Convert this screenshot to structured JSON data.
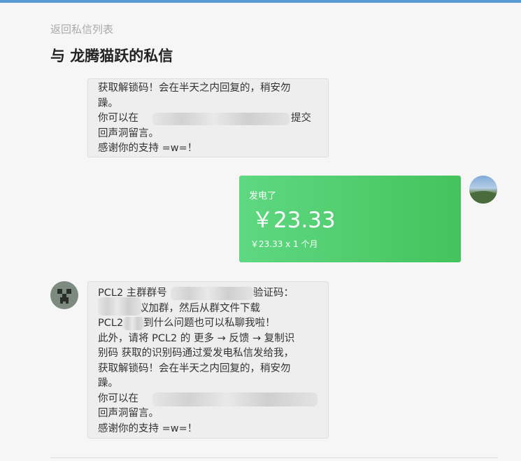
{
  "nav": {
    "back_label": "返回私信列表"
  },
  "header": {
    "title": "与 龙腾猫跃的私信"
  },
  "messages": {
    "first": {
      "lines": [
        "获取解锁码！会在半天之内回复的，稍安勿",
        "躁。",
        "你可以在",
        "提交",
        "回声洞留言。",
        "感谢你的支持 =w=！"
      ]
    },
    "sponsor": {
      "label": "发电了",
      "amount": "￥23.33",
      "detail": "￥23.33 x 1 个月"
    },
    "second": {
      "lines": [
        "PCL2 主群群号",
        "验证码：",
        "很强烈建议加群，然后从群文件下载",
        "PCL2，遇到什么问题也可以私聊我啦！",
        "此外，请将 PCL2 的 更多 → 反馈 → 复制识",
        "别码 获取的识别码通过爱发电私信发给我，",
        "获取解锁码！会在半天之内回复的，稍安勿",
        "躁。",
        "你可以在",
        "回声洞留言。",
        "感谢你的支持 =w=！"
      ]
    }
  },
  "colors": {
    "sponsor_start": "#5fd882",
    "sponsor_end": "#44c35c",
    "bubble": "#eeeeee",
    "top_bar": "#5b9bd5"
  },
  "icons": {
    "self_avatar": "landscape-avatar-icon",
    "other_avatar": "creeper-avatar-icon"
  }
}
